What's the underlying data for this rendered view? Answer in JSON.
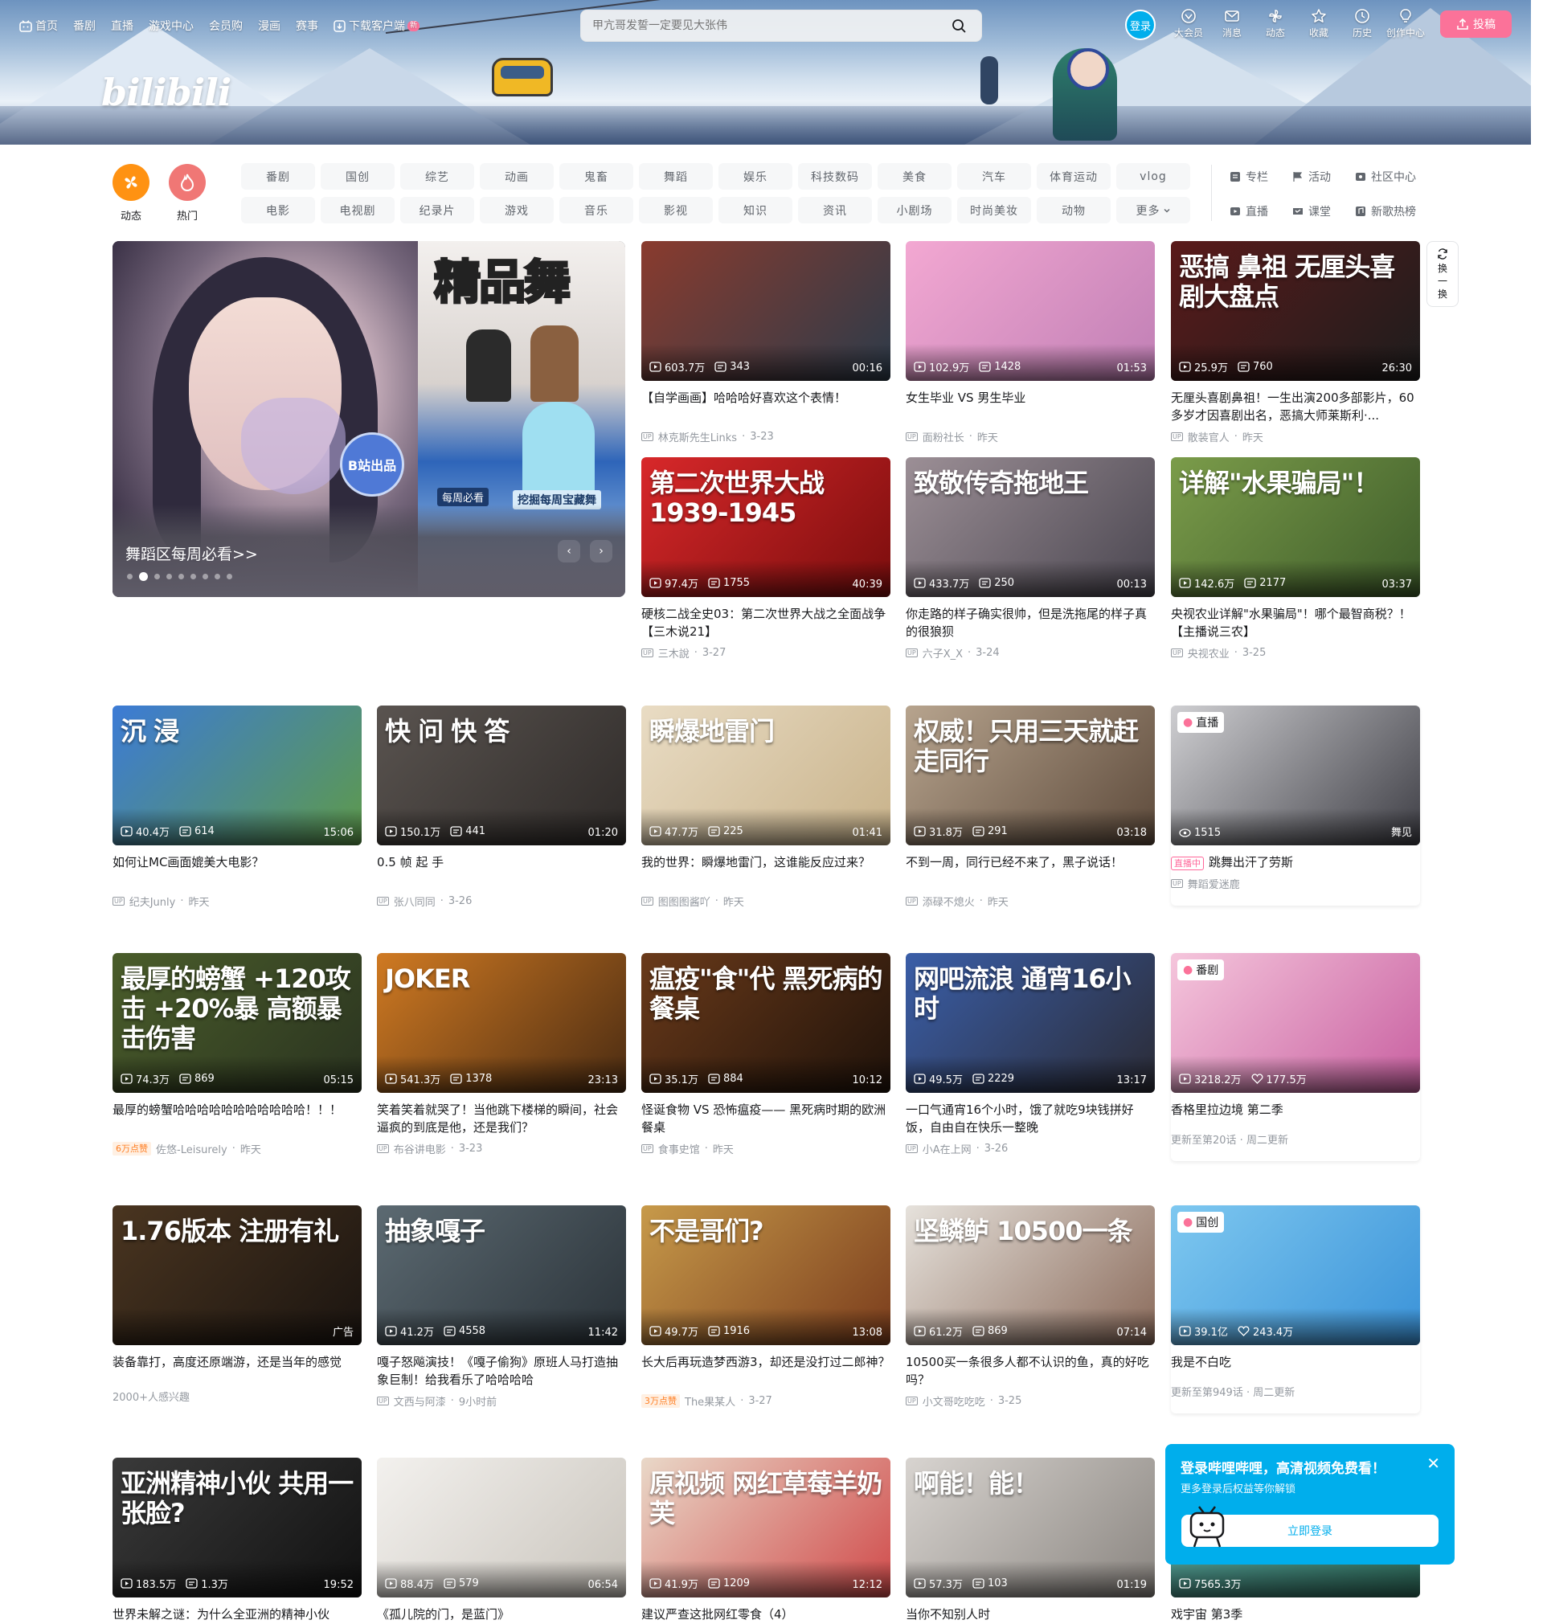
{
  "nav": {
    "items": [
      {
        "label": "首页",
        "icon": "tv-icon"
      },
      {
        "label": "番剧"
      },
      {
        "label": "直播"
      },
      {
        "label": "游戏中心"
      },
      {
        "label": "会员购"
      },
      {
        "label": "漫画"
      },
      {
        "label": "赛事"
      },
      {
        "label": "下载客户端",
        "icon": "download-icon",
        "badge": "新"
      }
    ]
  },
  "brand": {
    "logo_text": "bilibili"
  },
  "search": {
    "placeholder": "甲亢哥发誓一定要见大张伟",
    "icon": "search-icon"
  },
  "user_nav": {
    "login_label": "登录",
    "items": [
      {
        "label": "大会员",
        "icon": "vip-icon"
      },
      {
        "label": "消息",
        "icon": "message-icon"
      },
      {
        "label": "动态",
        "icon": "dynamic-icon"
      },
      {
        "label": "收藏",
        "icon": "star-icon"
      },
      {
        "label": "历史",
        "icon": "clock-icon"
      },
      {
        "label": "创作中心",
        "icon": "bulb-icon"
      }
    ],
    "upload_label": "投稿"
  },
  "channels": {
    "main": [
      {
        "label": "动态",
        "color": "#ff9212",
        "icon": "windmill-icon"
      },
      {
        "label": "热门",
        "color": "#f07775",
        "icon": "flame-icon"
      }
    ],
    "chips": [
      "番剧",
      "国创",
      "综艺",
      "动画",
      "鬼畜",
      "舞蹈",
      "娱乐",
      "科技数码",
      "美食",
      "汽车",
      "体育运动",
      "vlog",
      "电影",
      "电视剧",
      "纪录片",
      "游戏",
      "音乐",
      "影视",
      "知识",
      "资讯",
      "小剧场",
      "时尚美妆",
      "动物",
      "更多"
    ],
    "side": [
      {
        "label": "专栏",
        "icon": "article-icon"
      },
      {
        "label": "活动",
        "icon": "flag-icon"
      },
      {
        "label": "社区中心",
        "icon": "community-icon"
      },
      {
        "label": "直播",
        "icon": "live-icon"
      },
      {
        "label": "课堂",
        "icon": "class-icon"
      },
      {
        "label": "新歌热榜",
        "icon": "music-icon"
      }
    ]
  },
  "carousel": {
    "title": "舞蹈区每周必看>>",
    "badge": "B站出品",
    "poster_text": "精品舞",
    "tag1": "每周必看",
    "tag2": "挖掘每周宝藏舞",
    "dots": 9,
    "active": 1
  },
  "refresh": {
    "label": "换一换"
  },
  "cards": [
    {
      "thumb_text": "",
      "views": "603.7万",
      "danmaku": "343",
      "duration": "00:16",
      "title": "【自学画画】哈哈哈好喜欢这个表情！",
      "author": "林克斯先生Links",
      "date": "3-23",
      "bg": [
        "#8a3b2e",
        "#2c3b4a"
      ]
    },
    {
      "thumb_text": "",
      "views": "102.9万",
      "danmaku": "1428",
      "duration": "01:53",
      "title": "女生毕业 VS 男生毕业",
      "author": "面粉社长",
      "date": "昨天",
      "bg": [
        "#f3a8d2",
        "#c07fb5"
      ]
    },
    {
      "thumb_text": "恶搞 鼻祖 无厘头喜剧大盘点",
      "views": "25.9万",
      "danmaku": "760",
      "duration": "26:30",
      "title": "无厘头喜剧鼻祖！一生出演200多部影片，60多岁才因喜剧出名，恶搞大师莱斯利·...",
      "author": "散装官人",
      "date": "昨天",
      "bg": [
        "#5a1a1a",
        "#1d1d1d"
      ]
    },
    {
      "thumb_text": "第二次世界大战 1939-1945",
      "views": "97.4万",
      "danmaku": "1755",
      "duration": "40:39",
      "title": "硬核二战全史03：第二次世界大战之全面战争【三木说21】",
      "author": "三木說",
      "date": "3-27",
      "bg": [
        "#d8282a",
        "#7a0d0d"
      ]
    },
    {
      "thumb_text": "致敬传奇拖地王",
      "views": "433.7万",
      "danmaku": "250",
      "duration": "00:13",
      "title": "你走路的样子确实很帅，但是洗拖尾的样子真的很狼狈",
      "author": "六子X_X",
      "date": "3-24",
      "bg": [
        "#9c8f96",
        "#4a4650"
      ]
    },
    {
      "thumb_text": "详解\"水果骗局\"！",
      "views": "142.6万",
      "danmaku": "2177",
      "duration": "03:37",
      "title": "央视农业详解\"水果骗局\"！哪个最智商税？！【主播说三农】",
      "author": "央视农业",
      "date": "3-25",
      "bg": [
        "#7b9c4a",
        "#3e5c2a"
      ]
    },
    {
      "thumb_text": "沉 浸",
      "views": "40.4万",
      "danmaku": "614",
      "duration": "15:06",
      "title": "如何让MC画面媲美大电影？",
      "author": "纪夫Junly",
      "date": "昨天",
      "bg": [
        "#3c7bd6",
        "#5e9a4a"
      ]
    },
    {
      "thumb_text": "快 问 快 答",
      "views": "150.1万",
      "danmaku": "441",
      "duration": "01:20",
      "title": "0.5 帧 起 手",
      "author": "张八同同",
      "date": "3-26",
      "bg": [
        "#5a5450",
        "#2e2a28"
      ]
    },
    {
      "thumb_text": "瞬爆地雷门",
      "views": "47.7万",
      "danmaku": "225",
      "duration": "01:41",
      "title": "我的世界：瞬爆地雷门，这谁能反应过来？",
      "author": "图图图酱吖",
      "date": "昨天",
      "bg": [
        "#e9dcc4",
        "#c8b28a"
      ]
    },
    {
      "thumb_text": "权威！只用三天就赶走同行",
      "views": "31.8万",
      "danmaku": "291",
      "duration": "03:18",
      "title": "不到一周，同行已经不来了，黑子说话！",
      "author": "添碌不熄火",
      "date": "昨天",
      "bg": [
        "#b7a48e",
        "#5d4a3b"
      ]
    },
    {
      "live": true,
      "tag": "直播",
      "views": "1515",
      "duration": "舞见",
      "title": "跳舞出汗了劳斯",
      "live_badge": "直播中",
      "author": "舞蹈爱迷鹿",
      "bg": [
        "#cfcfd2",
        "#3e3e45"
      ]
    },
    {
      "thumb_text": "最厚的螃蟹 +120攻击 +20%暴 高额暴击伤害",
      "views": "74.3万",
      "danmaku": "869",
      "duration": "05:15",
      "title": "最厚的螃蟹哈哈哈哈哈哈哈哈哈哈哈！！！",
      "hot": "6万点赞",
      "author": "佐悠-Leisurely",
      "date": "昨天",
      "bg": [
        "#4a5d2a",
        "#2a3320"
      ]
    },
    {
      "thumb_text": "JOKER",
      "views": "541.3万",
      "danmaku": "1378",
      "duration": "23:13",
      "title": "笑着笑着就哭了！当他跳下楼梯的瞬间，社会逼疯的到底是他，还是我们？",
      "author": "布谷讲电影",
      "date": "3-23",
      "bg": [
        "#d07a22",
        "#4a2b12"
      ]
    },
    {
      "thumb_text": "瘟疫\"食\"代 黑死病的餐桌",
      "views": "35.1万",
      "danmaku": "884",
      "duration": "10:12",
      "title": "怪诞食物 VS 恐怖瘟疫—— 黑死病时期的欧洲餐桌",
      "author": "食事史馆",
      "date": "昨天",
      "bg": [
        "#6a3a1a",
        "#1f120a"
      ]
    },
    {
      "thumb_text": "网吧流浪 通宵16小时",
      "views": "49.5万",
      "danmaku": "2229",
      "duration": "13:17",
      "title": "一口气通宵16个小时，饿了就吃9块钱拼好饭，自由自在快乐一整晚",
      "author": "小A在上网",
      "date": "3-26",
      "bg": [
        "#3a5ea8",
        "#2b2b35"
      ]
    },
    {
      "tag": "番剧",
      "views": "3218.2万",
      "likes": "177.5万",
      "title": "香格里拉边境 第二季",
      "footer": "更新至第20话 · 周二更新",
      "bg": [
        "#f5c6dc",
        "#c85fa0"
      ]
    },
    {
      "thumb_text": "1.76版本 注册有礼",
      "ad": "广告",
      "title": "装备靠打，高度还原端游，还是当年的感觉",
      "footer": "2000+人感兴趣",
      "bg": [
        "#4a3520",
        "#1a1410"
      ]
    },
    {
      "thumb_text": "抽象嘎子",
      "views": "41.2万",
      "danmaku": "4558",
      "duration": "11:42",
      "title": "嘎子怒飚演技！《嘎子偷狗》原班人马打造抽象巨制！给我看乐了哈哈哈哈",
      "author": "文西与阿漆",
      "date": "9小时前",
      "bg": [
        "#5c6a72",
        "#2a3238"
      ]
    },
    {
      "thumb_text": "不是哥们?",
      "views": "49.7万",
      "danmaku": "1916",
      "duration": "13:08",
      "title": "长大后再玩造梦西游3，却还是没打过二郎神？",
      "hot": "3万点赞",
      "author": "The果某人",
      "date": "3-27",
      "bg": [
        "#c79a4a",
        "#7a3c1c"
      ]
    },
    {
      "thumb_text": "坚鳞鲈 10500一条",
      "views": "61.2万",
      "danmaku": "869",
      "duration": "07:14",
      "title": "10500买一条很多人都不认识的鱼，真的好吃吗？",
      "author": "小文哥吃吃吃",
      "date": "3-25",
      "bg": [
        "#e6e2dc",
        "#8a6a5a"
      ]
    },
    {
      "tag": "国创",
      "views": "39.1亿",
      "likes": "243.4万",
      "title": "我是不白吃",
      "footer": "更新至第949话 · 周二更新",
      "bg": [
        "#7ec8f0",
        "#3a92d8"
      ]
    },
    {
      "thumb_text": "亚洲精神小伙 共用一张脸?",
      "views": "183.5万",
      "danmaku": "1.3万",
      "duration": "19:52",
      "title": "世界未解之谜：为什么全亚洲的精神小伙",
      "bg": [
        "#3a3a3a",
        "#111"
      ]
    },
    {
      "thumb_text": "",
      "views": "88.4万",
      "danmaku": "579",
      "duration": "06:54",
      "title": "《孤儿院的门，是蓝门》",
      "bg": [
        "#f3f1ee",
        "#c9c4bc"
      ]
    },
    {
      "thumb_text": "原视频 网红草莓羊奶芙",
      "views": "41.9万",
      "danmaku": "1209",
      "duration": "12:12",
      "title": "建议严查这批网红零食（4）",
      "bg": [
        "#e9d8c8",
        "#d04a4a"
      ]
    },
    {
      "thumb_text": "啊能！能！",
      "views": "57.3万",
      "danmaku": "103",
      "duration": "01:19",
      "title": "当你不知别人时",
      "bg": [
        "#d8d4d0",
        "#8a8580"
      ]
    },
    {
      "views": "7565.3万",
      "title": "戏宇宙 第3季",
      "bg": [
        "#5aa8a0",
        "#2e6a5a"
      ]
    }
  ],
  "login_popup": {
    "heading": "登录哔哩哔哩，高清视频免费看！",
    "sub": "更多登录后权益等你解锁",
    "button": "立即登录"
  }
}
